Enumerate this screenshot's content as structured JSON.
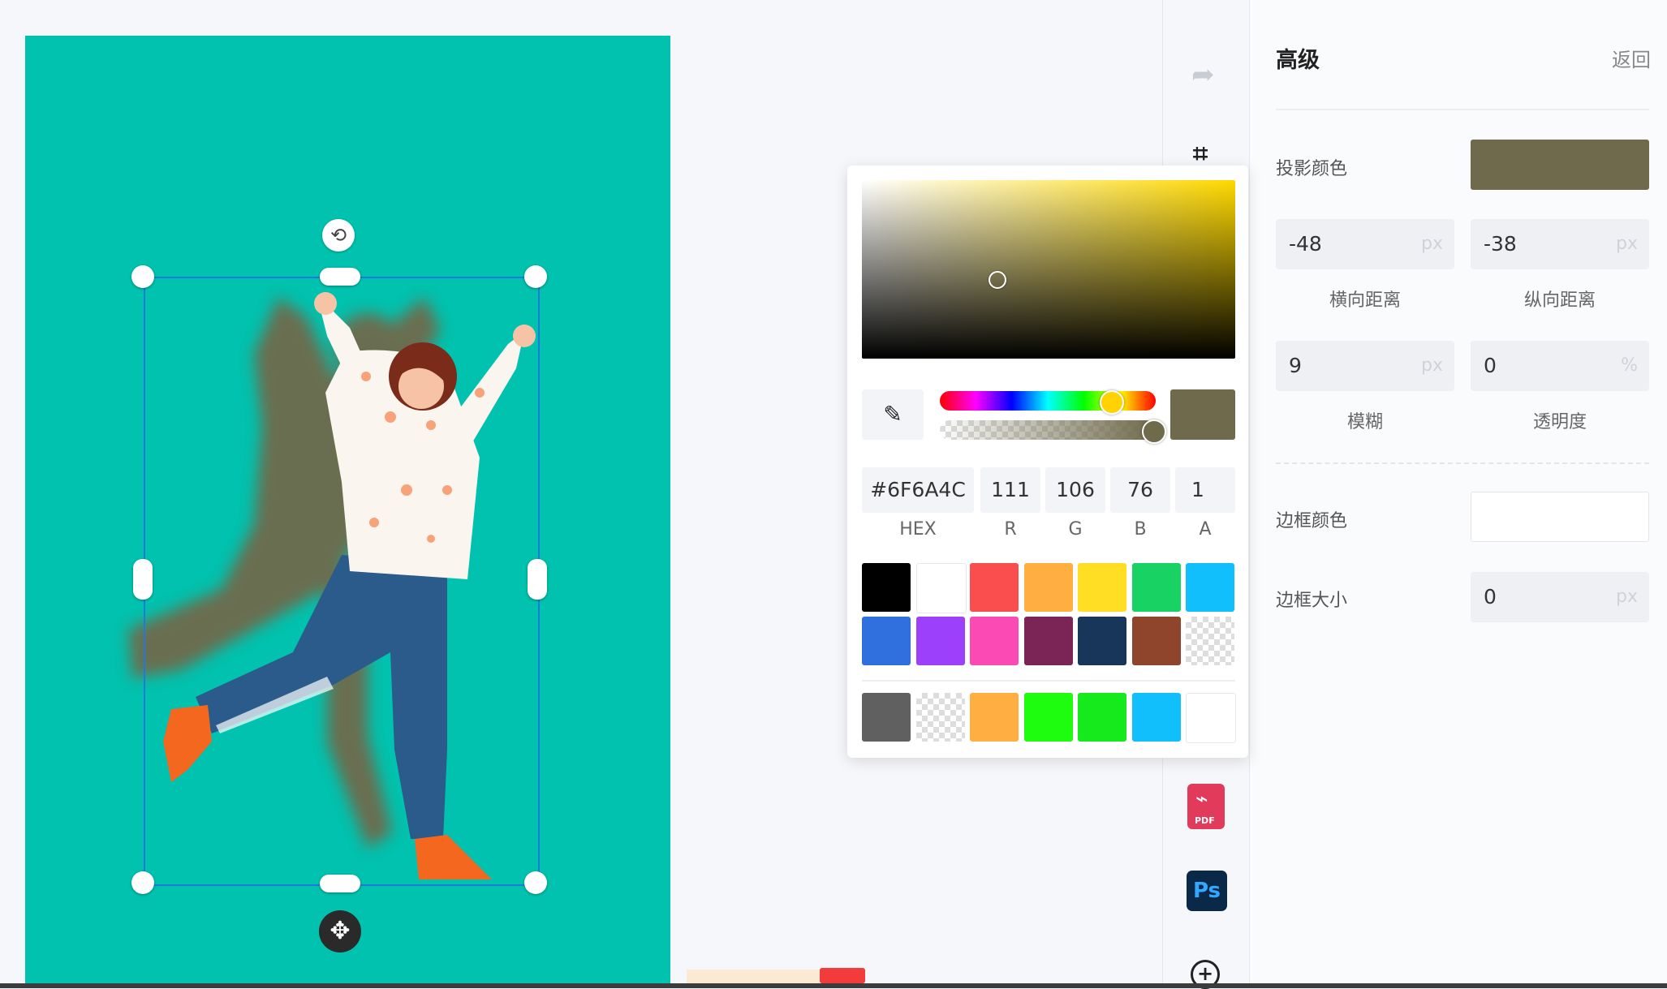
{
  "panel": {
    "title": "高级",
    "back": "返回",
    "shadow_color_label": "投影颜色",
    "shadow_color": "#6f6a4c",
    "offset_x": {
      "value": "-48",
      "unit": "px",
      "caption": "横向距离"
    },
    "offset_y": {
      "value": "-38",
      "unit": "px",
      "caption": "纵向距离"
    },
    "blur": {
      "value": "9",
      "unit": "px",
      "caption": "模糊"
    },
    "opacity": {
      "value": "0",
      "unit": "%",
      "caption": "透明度"
    },
    "border_color_label": "边框颜色",
    "border_size_label": "边框大小",
    "border_size": {
      "value": "0",
      "unit": "px"
    }
  },
  "picker": {
    "hex": "#6F6A4C",
    "r": "111",
    "g": "106",
    "b": "76",
    "a": "1",
    "labels": {
      "hex": "HEX",
      "r": "R",
      "g": "G",
      "b": "B",
      "a": "A"
    },
    "current_color": "#6f6a4c",
    "preset_row1": [
      "#000000",
      "#ffffff",
      "#fa4e4e",
      "#ffae42",
      "#ffde24",
      "#18d364",
      "#10bffc"
    ],
    "preset_row2": [
      "#2f6fde",
      "#9d40fb",
      "#fc4ab4",
      "#7b2556",
      "#173659",
      "#8e452b",
      "transparent"
    ],
    "recent": [
      "#606060",
      "transparent",
      "#ffae42",
      "#1efc0f",
      "#17ea1c",
      "#10bffc",
      "#ffffff"
    ]
  },
  "toolbar": {
    "icons": [
      "redo-icon",
      "crop-icon",
      "pdf-icon",
      "photoshop-icon",
      "add-icon"
    ],
    "pdf_label": "PDF",
    "ps_label": "Ps"
  },
  "canvas": {
    "background": "#00c2ae"
  }
}
